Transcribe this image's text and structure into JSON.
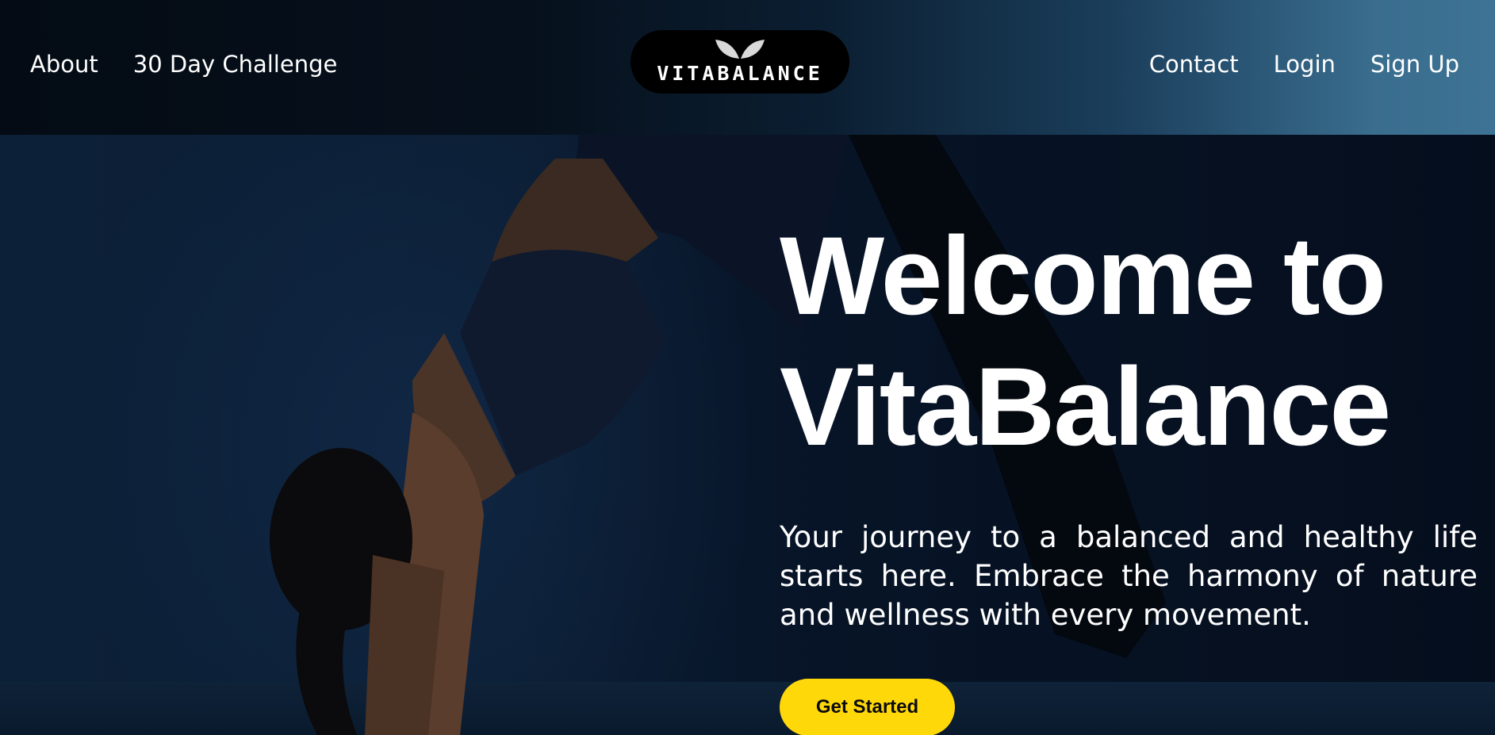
{
  "brand": {
    "logo_text": "VITABALANCE",
    "logo_icon": "leaves-icon"
  },
  "nav": {
    "left": [
      {
        "label": "About"
      },
      {
        "label": "30 Day Challenge"
      }
    ],
    "right": [
      {
        "label": "Contact"
      },
      {
        "label": "Login"
      },
      {
        "label": "Sign Up"
      }
    ]
  },
  "hero": {
    "title_line1": "Welcome to",
    "title_line2": "VitaBalance",
    "subtitle": "Your journey to a balanced and healthy life starts here. Embrace the harmony of nature and wellness with every movement.",
    "cta_label": "Get Started"
  },
  "colors": {
    "accent": "#ffd80a",
    "background": "#061223",
    "text": "#ffffff"
  }
}
